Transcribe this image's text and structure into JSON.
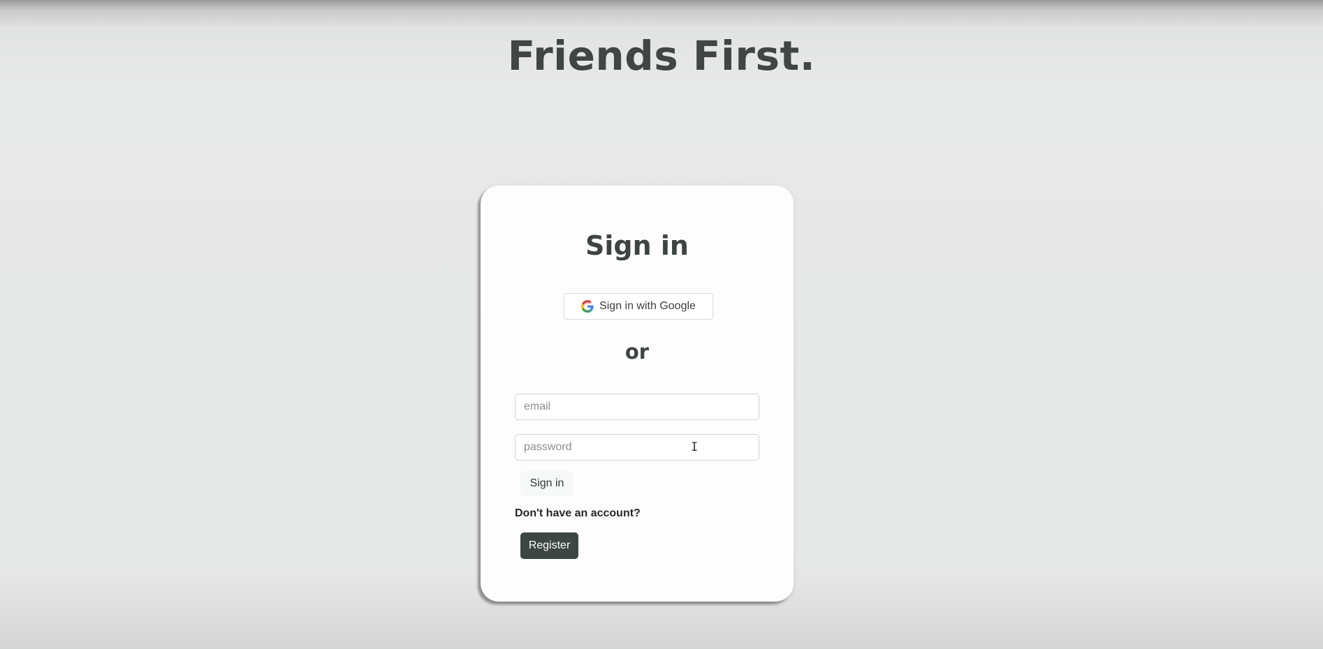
{
  "app": {
    "title": "Friends First."
  },
  "card": {
    "title": "Sign in",
    "google_button_label": "Sign in with Google",
    "google_icon": "google-g-icon",
    "or_label": "or",
    "email": {
      "placeholder": "email",
      "value": ""
    },
    "password": {
      "placeholder": "password",
      "value": ""
    },
    "signin_label": "Sign in",
    "no_account_text": "Don't have an account?",
    "register_label": "Register"
  },
  "colors": {
    "page_background": "#e8e9e9",
    "card_background": "#fdfdfd",
    "text": "#3e4442",
    "register_button": "#3d4643"
  }
}
